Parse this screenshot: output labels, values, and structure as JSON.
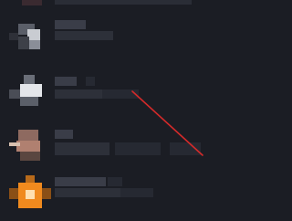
{
  "list": {
    "items": [
      {
        "thumb_icon": "square-thumbnail-gray",
        "thumb_accent": "#c9ccd2"
      },
      {
        "thumb_icon": "square-thumbnail-white",
        "thumb_accent": "#e4e6ea"
      },
      {
        "thumb_icon": "square-thumbnail-tan",
        "thumb_accent": "#b08070"
      },
      {
        "thumb_icon": "square-thumbnail-orange",
        "thumb_accent": "#f08a1e"
      }
    ]
  },
  "annotation": {
    "icon": "red-line-annotation",
    "color": "#d42a2a"
  },
  "colors": {
    "background": "#1b1d24",
    "placeholder_bar": "#2d3039"
  }
}
